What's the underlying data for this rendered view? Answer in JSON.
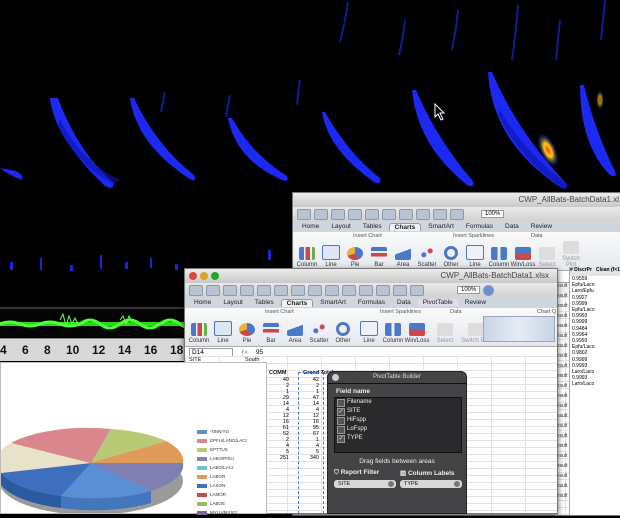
{
  "axis": {
    "ticks": [
      "4",
      "6",
      "8",
      "10",
      "12",
      "14",
      "16",
      "18"
    ]
  },
  "back_window": {
    "title": "CWP_AllBats-BatchData1.xl",
    "tabs": [
      "Home",
      "Layout",
      "Tables",
      "Charts",
      "SmartArt",
      "Formulas",
      "Data",
      "Review"
    ],
    "active_tab": "Charts",
    "zoom": "100%",
    "name_box": "A1",
    "groups": [
      "Insert Chart",
      "Insert Sparklines",
      "Data"
    ],
    "buttons": [
      "Column",
      "Line",
      "Pie",
      "Bar",
      "Area",
      "Scatter",
      "Other",
      "Line",
      "Column",
      "Win/Loss",
      "Select",
      "Switch Plot"
    ],
    "col_headers": [
      "A",
      "B",
      "C",
      "D",
      "E",
      "F",
      "G",
      "H",
      "I",
      "J",
      "K",
      "L",
      "M"
    ],
    "right_headers": [
      "# DiscrPr",
      "Clean (f<1"
    ],
    "right_values": [
      "0.9559",
      "",
      "",
      "Epfu/Laco",
      "",
      "Laro/Epfu",
      "",
      "",
      "",
      "",
      "",
      "",
      "",
      "",
      "0.9927",
      "0.9999",
      "Epfu/Laco",
      "0.9993",
      "0.9999",
      "",
      "",
      "",
      "",
      "0.9484",
      "0.9964",
      "0.9993",
      "Epfu/Laco",
      "",
      "",
      "0.9802",
      "0.9999",
      "",
      "",
      "",
      "0.9993",
      "",
      "Laro/Laco",
      "0.9993",
      "",
      "Laro/Laco"
    ],
    "result_label": "result"
  },
  "front_window": {
    "title": "CWP_AllBats-BatchData1.xlsx",
    "tabs": [
      "Home",
      "Layout",
      "Tables",
      "Charts",
      "SmartArt",
      "Formulas",
      "Data",
      "PivotTable",
      "Review"
    ],
    "active_tab": "Charts",
    "zoom": "100%",
    "name_box": "D14",
    "formula_value": "95",
    "groups": [
      "Insert Chart",
      "Insert Sparklines",
      "Data",
      "Chart Q"
    ],
    "buttons": [
      "Column",
      "Line",
      "Pie",
      "Bar",
      "Area",
      "Scatter",
      "Other",
      "Line",
      "Column",
      "Win/Loss",
      "Select",
      "Switch Plot"
    ],
    "col_headers": [
      "A",
      "B",
      "C",
      "D",
      "E",
      "F",
      "G",
      "H",
      "I",
      "J"
    ],
    "row1_a": "SITE",
    "row1_b": "South",
    "c_header": "COMM",
    "d_header": "Grand Total",
    "c_values": [
      "40",
      "2",
      "1",
      "29",
      "14",
      "4",
      "12",
      "16",
      "61",
      "52",
      "2",
      "4",
      "5",
      "251"
    ],
    "d_values": [
      "42",
      "2",
      "1",
      "47",
      "14",
      "4",
      "12",
      "16",
      "95",
      "67",
      "1",
      "4",
      "5",
      "340"
    ]
  },
  "pie_legend": [
    "-NNN/YO",
    "EPFU/LANO/LACI",
    "EPTTUS",
    "LABO/PISU",
    "LABO/LACI",
    "LABOR",
    "LASON",
    "LAMOR",
    "LABOE",
    "MYLU/MYSO"
  ],
  "pivot_builder": {
    "title": "PivotTable Builder",
    "field_name_header": "Field name",
    "fields": [
      {
        "name": "Filename",
        "checked": false
      },
      {
        "name": "SITE",
        "checked": true
      },
      {
        "name": "HiFspp",
        "checked": false
      },
      {
        "name": "LoFspp",
        "checked": false
      },
      {
        "name": "TYPE",
        "checked": true
      }
    ],
    "drag_text": "Drag fields between areas",
    "report_filter_label": "Report Filter",
    "column_labels_label": "Column Labels",
    "report_filter_field": "SITE",
    "column_labels_field": "TYPE"
  },
  "colors": {
    "spectro_blue": "#1f2bff",
    "scope_green": "#3cff2a",
    "pivot_tab": "#e8d7ef"
  }
}
